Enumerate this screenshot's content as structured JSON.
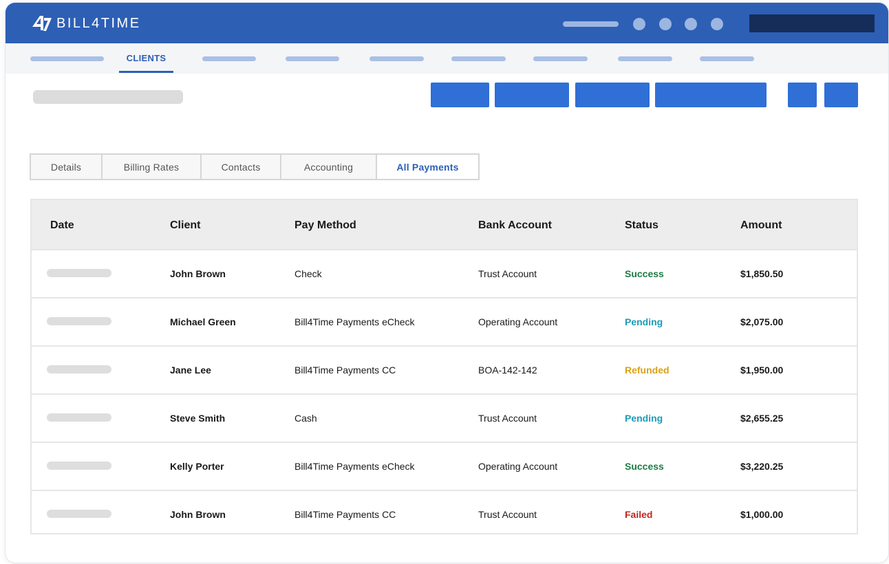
{
  "app": {
    "brand": "BILL4TIME",
    "icons": {
      "logo": "bill4time-logo-mark"
    }
  },
  "nav": {
    "active_label": "CLIENTS"
  },
  "tabs": [
    {
      "label": "Details",
      "active": false
    },
    {
      "label": "Billing Rates",
      "active": false
    },
    {
      "label": "Contacts",
      "active": false
    },
    {
      "label": "Accounting",
      "active": false
    },
    {
      "label": "All Payments",
      "active": true
    }
  ],
  "table": {
    "columns": [
      "Date",
      "Client",
      "Pay Method",
      "Bank Account",
      "Status",
      "Amount"
    ],
    "rows": [
      {
        "client": "John Brown",
        "pay_method": "Check",
        "bank_account": "Trust Account",
        "status": "Success",
        "amount": "$1,850.50"
      },
      {
        "client": "Michael Green",
        "pay_method": "Bill4Time Payments eCheck",
        "bank_account": "Operating Account",
        "status": "Pending",
        "amount": "$2,075.00"
      },
      {
        "client": "Jane Lee",
        "pay_method": "Bill4Time Payments CC",
        "bank_account": "BOA-142-142",
        "status": "Refunded",
        "amount": "$1,950.00"
      },
      {
        "client": "Steve Smith",
        "pay_method": "Cash",
        "bank_account": "Trust Account",
        "status": "Pending",
        "amount": "$2,655.25"
      },
      {
        "client": "Kelly Porter",
        "pay_method": "Bill4Time Payments eCheck",
        "bank_account": "Operating Account",
        "status": "Success",
        "amount": "$3,220.25"
      },
      {
        "client": "John Brown",
        "pay_method": "Bill4Time Payments CC",
        "bank_account": "Trust Account",
        "status": "Failed",
        "amount": "$1,000.00"
      }
    ]
  },
  "colors": {
    "brand": "#2d5fb5",
    "header_bg": "#2d5fb5",
    "action_button": "#2f6fd6",
    "status_success": "#1e7a45",
    "status_pending": "#1a9cb8",
    "status_refunded": "#d9a317",
    "status_failed": "#c0261c"
  }
}
